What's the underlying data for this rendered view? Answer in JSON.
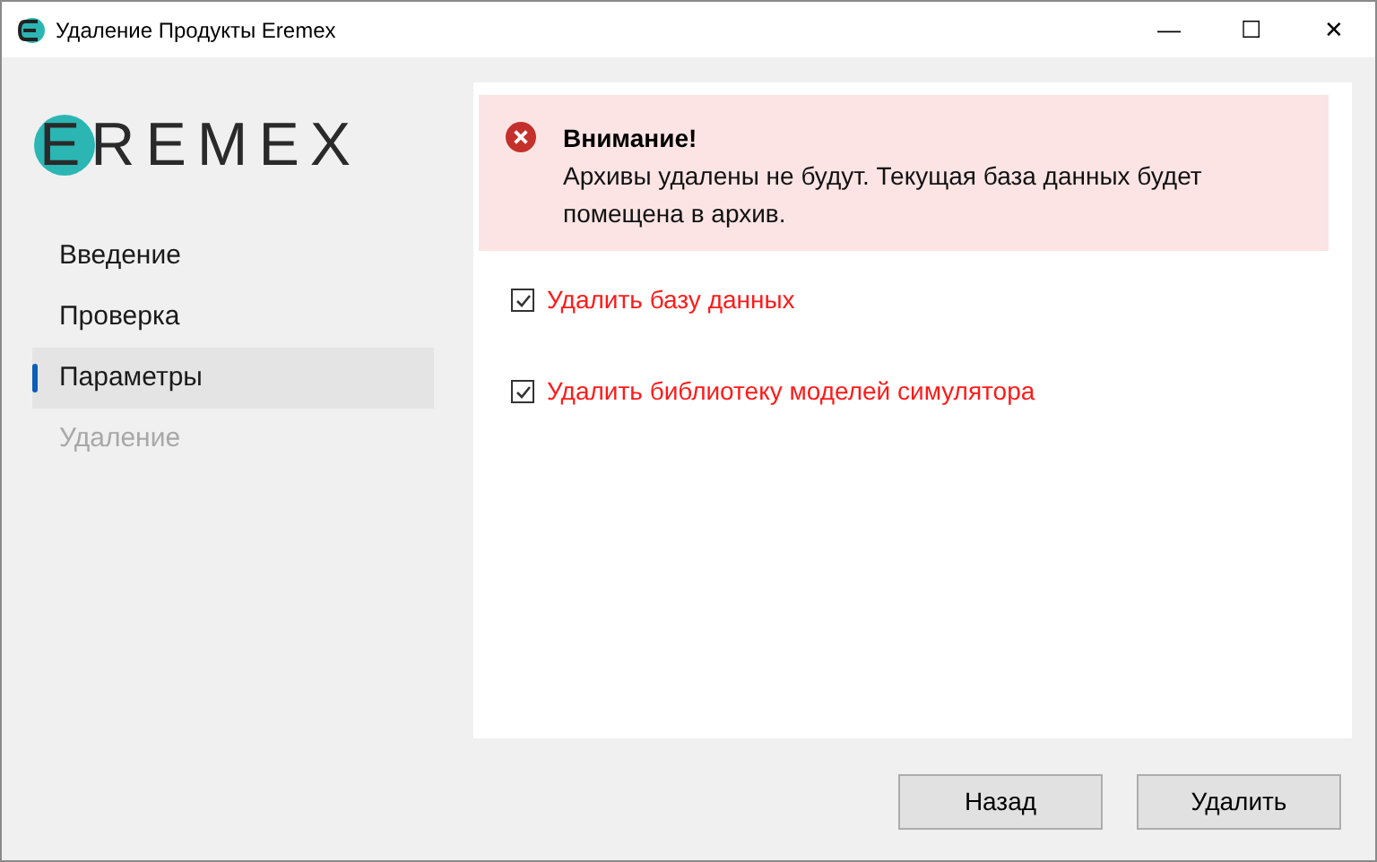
{
  "window": {
    "title": "Удаление Продукты Eremex",
    "controls": [
      "—",
      "☐",
      "✕"
    ]
  },
  "logo": {
    "text": "EREMEX"
  },
  "sidebar": {
    "items": [
      {
        "label": "Введение",
        "selected": false,
        "disabled": false
      },
      {
        "label": "Проверка",
        "selected": false,
        "disabled": false
      },
      {
        "label": "Параметры",
        "selected": true,
        "disabled": false
      },
      {
        "label": "Удаление",
        "selected": false,
        "disabled": true
      }
    ]
  },
  "alert": {
    "title": "Внимание!",
    "message": "Архивы удалены не будут. Текущая база данных будет помещена в архив."
  },
  "options": [
    {
      "label": "Удалить базу данных",
      "checked": true
    },
    {
      "label": "Удалить библиотеку моделей симулятора",
      "checked": true
    }
  ],
  "buttons": [
    "Назад",
    "Удалить"
  ]
}
